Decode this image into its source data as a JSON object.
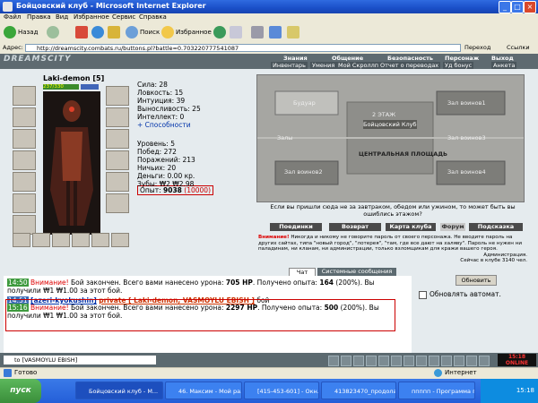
{
  "window": {
    "title": "Бойцовский клуб - Microsoft Internet Explorer"
  },
  "menu": [
    "Файл",
    "Правка",
    "Вид",
    "Избранное",
    "Сервис",
    "Справка"
  ],
  "toolbar": {
    "back": "Назад",
    "search": "Поиск",
    "favorites": "Избранное"
  },
  "address": {
    "label": "Адрес:",
    "url": "http://dreamscity.combats.ru/buttons.pl?battle=0.703220777541087",
    "go": "Переход",
    "links": "Ссылки"
  },
  "game": {
    "logo": "DREAMSCITY",
    "nav": [
      "Знания",
      "Общение",
      "Безопасность",
      "Персонаж",
      "Выход"
    ],
    "subnav": [
      "Инвентарь",
      "Умения",
      "Мой Скроллп",
      "Отчет о переводах",
      "Уд бонус",
      "Анкета"
    ],
    "character": {
      "name": "Laki-demon",
      "level_tag": "[5]",
      "hp": "237/330"
    },
    "stats": [
      "Сила: 28",
      "Ловкость: 15",
      "Интуиция: 39",
      "Выносливость: 25",
      "Интеллект: 0",
      "+ Способности"
    ],
    "experience": {
      "label": "Опыт:",
      "value": "9038",
      "next": "(10000)"
    },
    "stats2": [
      "Уровень: 5",
      "Побед: 272",
      "Поражений: 213",
      "Ничьих: 20",
      "Деньги: 0.00 кр.",
      "Зубы: ₩2 ₩2.98"
    ],
    "map": {
      "buildings": [
        "Будуар",
        "Зал воинов1",
        "2 ЭТАЖ",
        "Залы",
        "Бойцовский Клуб",
        "Зал воинов3",
        "ЦЕНТРАЛЬНАЯ ПЛОЩАДЬ",
        "Зал воинов2",
        "Зал воинов4"
      ],
      "caption": "Если вы пришли сюда не за завтраком, обедом или ужином, то может быть вы ошиблись этажом?"
    },
    "map_buttons": [
      "Поединки",
      "Возврат",
      "Карта клуба",
      "Форум",
      "Подсказка"
    ],
    "warning": {
      "title": "Внимание!",
      "body": "Никогда и никому не говорите пароль от своего персонажа. Не вводите пароль на других сайтах, типа \"новый город\", \"лотерея\", \"там, где все дают на халяву\". Пароль не нужен ни паладинам, ни кланам, ни администрации, только взломщикам для кражи вашего героя.",
      "admin": "Администрация.",
      "online": "Сейчас в клубе 3140 чел."
    },
    "chat_tabs": [
      "Чат",
      "Системные сообщения"
    ],
    "chat": [
      {
        "time": "14:50",
        "warn": "Внимание!",
        "text1": "Бой закончен. Всего вами нанесено урона: ",
        "dmg": "705 HP",
        "text2": ". Получено опыта: ",
        "exp": "164",
        "text3": " (200%). Вы",
        "text4": "получили ₩1 ₩1.00 за этот бой."
      },
      {
        "time": "14:51",
        "warn": "[azeri-kyokushin]",
        "text1": "private [ Laki-demon, VASMOYLU EBISH ]",
        "text2": " бой"
      },
      {
        "time": "15:16",
        "warn": "Внимание!",
        "text1": "Бой закончен. Всего вами нанесено урона: ",
        "dmg": "2297 HP",
        "text2": ". Получено опыта: ",
        "exp": "500",
        "text3": " (200%). Вы",
        "text4": "получили ₩1 ₩1.00 за этот бой."
      }
    ],
    "right_panel": {
      "refresh": "Обновить",
      "auto": "Обновлять автомат."
    },
    "input": {
      "value": "to [VASMOYLU EBISH]"
    },
    "clock": {
      "line1": "15:18",
      "line2": "ONLINE"
    }
  },
  "status": {
    "left": "Готово",
    "zone": "Интернет"
  },
  "taskbar": {
    "start": "пуск",
    "tasks": [
      "Бойцовский клуб - M...",
      "46. Максим - Мой ра...",
      "[415-453-601] - Окн...",
      "413823470_продола...",
      "ппппп - Программа п..."
    ],
    "time": "15:18"
  },
  "colors": {
    "title_blue": "#245ed8",
    "game_bg": "#e5ebee",
    "red_highlight": "#cc0000",
    "chat_green": "#3e9a3e"
  }
}
